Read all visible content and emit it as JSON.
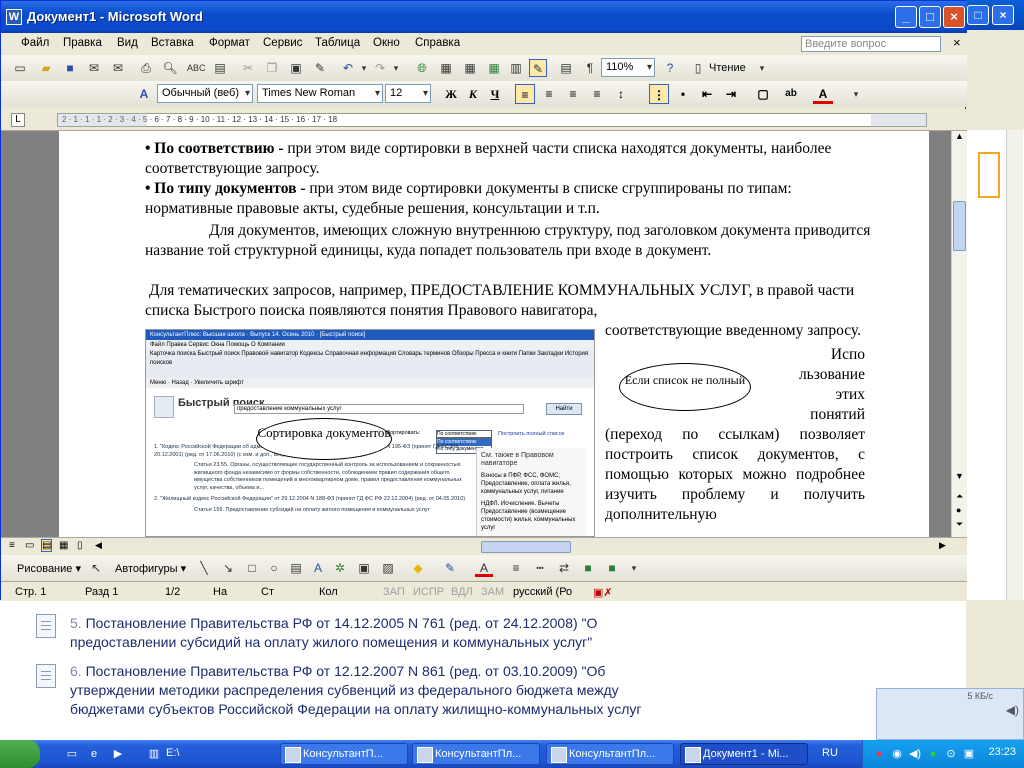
{
  "window": {
    "title": "Документ1 - Microsoft Word",
    "controls": {
      "minimize": "_",
      "maximize": "□",
      "close": "×"
    }
  },
  "menu": {
    "items": [
      "Файл",
      "Правка",
      "Вид",
      "Вставка",
      "Формат",
      "Сервис",
      "Таблица",
      "Окно",
      "Справка"
    ],
    "ask_placeholder": "Введите вопрос",
    "doc_close": "×"
  },
  "standard_toolbar": {
    "zoom": "110%",
    "read_label": "Чтение"
  },
  "format_toolbar": {
    "style": "Обычный (веб)",
    "font": "Times New Roman",
    "size": "12",
    "bold": "Ж",
    "italic": "К",
    "underline": "Ч"
  },
  "ruler": {
    "tab_selector": "L",
    "ticks": "2 · 1 · 1 · 1 · 2 · 3 · 4 · 5 · 6 · 7 · 8 · 9 · 10 · 11 · 12 · 13 · 14 · 15 · 16 · 17 · 18"
  },
  "document": {
    "para1_bold": "• По соответствию -",
    "para1_rest": " при этом виде сортировки в верхней части списка находятся документы, наиболее соответствующие запросу.",
    "para2_bold": "• По типу документов -",
    "para2_rest": " при этом виде сортировки документы в списке сгруппированы по типам: нормативные правовые акты, судебные решения, консультации и т.п.",
    "para3": "Для документов, имеющих сложную внутреннюю структуру, под заголовком документа приводится название той структурной единицы, куда попадет пользователь при входе в документ.",
    "para4": "Для тематических запросов, например, ПРЕДОСТАВЛЕНИЕ КОММУНАЛЬНЫХ УСЛУГ, в правой части списка Быстрого поиска появляются понятия Правового навигатора,",
    "right_col_1": "соответствующие введенному запросу.",
    "right_col_2a": "Испо",
    "right_col_2b": "льзование",
    "right_col_2c": "этих",
    "right_col_2d": "понятий",
    "right_col_3": "(переход по ссылкам) позволяет построить список документов, с помощью которых можно подробнее изучить проблему и получить дополнительную"
  },
  "embedded": {
    "title": "КонсультантПлюс: Высшая школа · Выпуск 14. Осень 2010 · [Быстрый поиск]",
    "menu": "Файл  Правка  Сервис  Окна  Помощь  О Компании",
    "toolbar": "Карточка поиска   Быстрый поиск   Правовой навигатор   Кодексы   Справочная информация   Словарь терминов   Обзоры   Пресса и книги   Папки   Закладки   История поисков",
    "toolbar2": "Меню  ·  Назад  ·  Увеличить шрифт",
    "quick_title": "Быстрый поиск",
    "query": "предоставление коммунальных услуг",
    "find": "Найти",
    "sort_label": "Сортировать:",
    "sort_value": "По соответствию",
    "sort_options": [
      "По соответствию",
      "По типу документов"
    ],
    "full_list": "Построить полный список",
    "see_also": "См. также в Правовом навигаторе",
    "see_also_items": [
      "Взносы в ПФР, ФСС, ФОМС;",
      "Предоставление, оплата жилья, коммунальных услуг, питание",
      "НДФЛ. Исчисление. Вычеты",
      "Предоставление (возмещение стоимости) жилья, коммунальных услуг"
    ],
    "results": [
      "1. \"Кодекс Российской Федерации об административных правонарушениях\" от 30.12.2001 N 195-ФЗ (принят ГД ФС РФ 20.12.2001) (ред. от 17.06.2010) (с изм. и доп., вступающими в силу с 01.07.2010)",
      "Статья 23.55. Органы, осуществляющие государственный контроль за использованием и сохранностью жилищного фонда независимо от формы собственности, соблюдением правил содержания общего имущества собственников помещений в многоквартирном доме, правил предоставления коммунальных услуг, качества, объема и...",
      "2. \"Жилищный кодекс Российской Федерации\" от 29.12.2004 N 188-ФЗ (принят ГД ФС РФ 22.12.2004) (ред. от 04.05.2010)",
      "Статья 159. Предоставление субсидий на оплату жилого помещения и коммунальных услуг"
    ]
  },
  "callouts": {
    "incomplete": "Если список не полный",
    "sort": "Сортировка документов"
  },
  "drawing_toolbar": {
    "draw_label": "Рисование",
    "autoshapes_label": "Автофигуры"
  },
  "status": {
    "page": "Стр. 1",
    "section": "Разд 1",
    "pages": "1/2",
    "at": "На",
    "line": "Ст",
    "col": "Кол",
    "rec": "ЗАП",
    "trk": "ИСПР",
    "ext": "ВДЛ",
    "ovr": "ЗАМ",
    "lang": "русский (Ро"
  },
  "background_list": [
    {
      "num": "5.",
      "text": "Постановление Правительства РФ от 14.12.2005 N 761 (ред. от 24.12.2008) \"О предоставлении субсидий на оплату жилого помещения и коммунальных услуг\""
    },
    {
      "num": "6.",
      "text": "Постановление Правительства РФ от 12.12.2007 N 861 (ред. от 03.10.2009) \"Об утверждении методики распределения субвенций из федерального бюджета между бюджетами субъектов Российской Федерации на оплату жилищно-коммунальных услуг"
    }
  ],
  "speed_widget": {
    "label": "5 КБ/с"
  },
  "taskbar": {
    "quick_drive": "E:\\",
    "tasks": [
      "КонсультантП...",
      "КонсультантПл...",
      "КонсультантПл...",
      "Документ1 - Mi..."
    ],
    "lang": "RU",
    "clock": "23:23"
  }
}
